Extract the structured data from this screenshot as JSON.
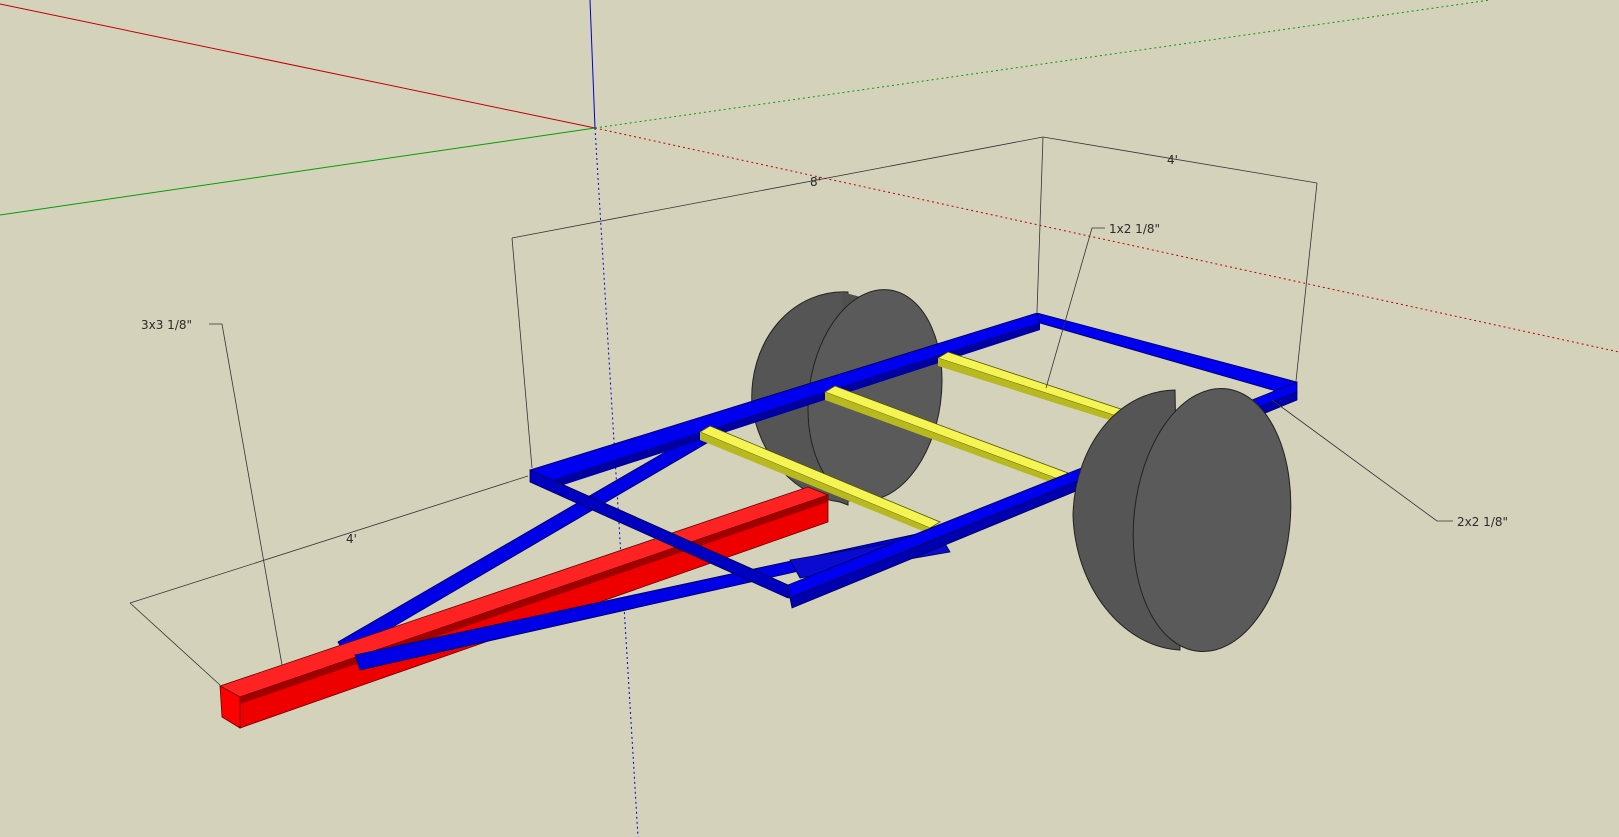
{
  "scene": {
    "background": "#d4d2bb",
    "colors": {
      "tongue_red": "#ff0000",
      "frame_blue": "#0000e6",
      "crossmember_yellow": "#f0f040",
      "wheel_gray": "#555555",
      "axis_red": "#c00000",
      "axis_green": "#00a000",
      "axis_blue": "#0000cc"
    }
  },
  "dimensions": {
    "length_8ft": "8'",
    "width_4ft": "4'",
    "tongue_4ft": "4'"
  },
  "labels": {
    "crossmember": "1x2 1/8\"",
    "tongue": "3x3 1/8\"",
    "frame": "2x2 1/8\""
  }
}
